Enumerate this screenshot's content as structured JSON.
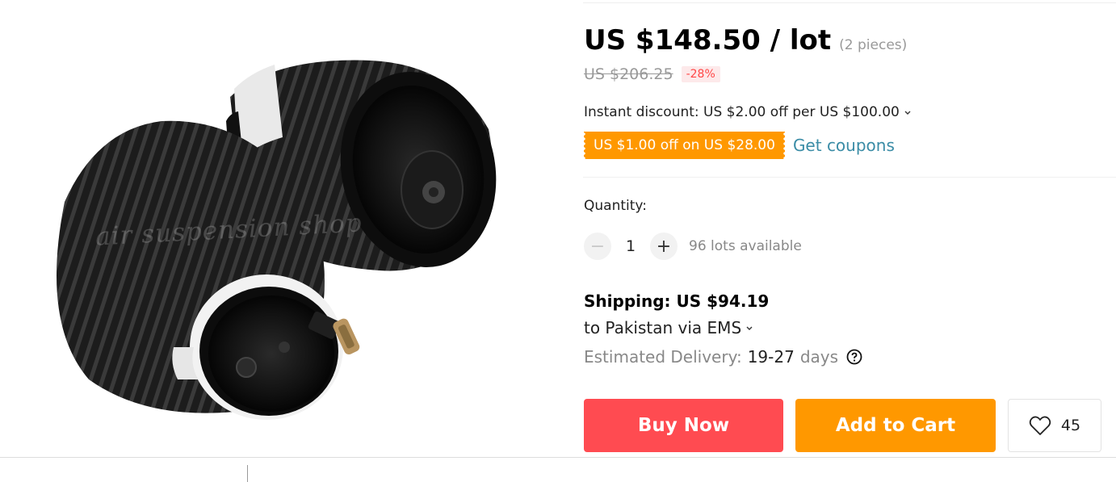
{
  "product": {
    "image_name": "air suspension bellows pair",
    "watermark": "air suspension shop"
  },
  "price": {
    "current": "US $148.50 / lot",
    "pieces": "(2 pieces)",
    "original": "US $206.25",
    "discount": "-28%"
  },
  "promotions": {
    "instant_discount": "Instant discount: US $2.00 off per US $100.00",
    "coupon": "US $1.00 off on US $28.00",
    "get_coupons": "Get coupons"
  },
  "quantity": {
    "label": "Quantity:",
    "minus": "−",
    "value": "1",
    "plus": "+",
    "available": "96 lots available"
  },
  "shipping": {
    "cost": "Shipping: US $94.19",
    "destination": "to Pakistan via EMS",
    "estimated_label": "Estimated Delivery:",
    "range": "19-27",
    "days": "days"
  },
  "actions": {
    "buy_now": "Buy Now",
    "add_to_cart": "Add to Cart",
    "wishlist_count": "45"
  },
  "colors": {
    "buy_now": "#ff4b51",
    "add_to_cart": "#ff9800",
    "coupon": "#ff9800",
    "link": "#3a8ca6",
    "discount_text": "#ff4747"
  },
  "icons": {
    "chevron": "chevron-down-icon",
    "help": "question-circle-icon",
    "wishlist": "heart-icon"
  }
}
